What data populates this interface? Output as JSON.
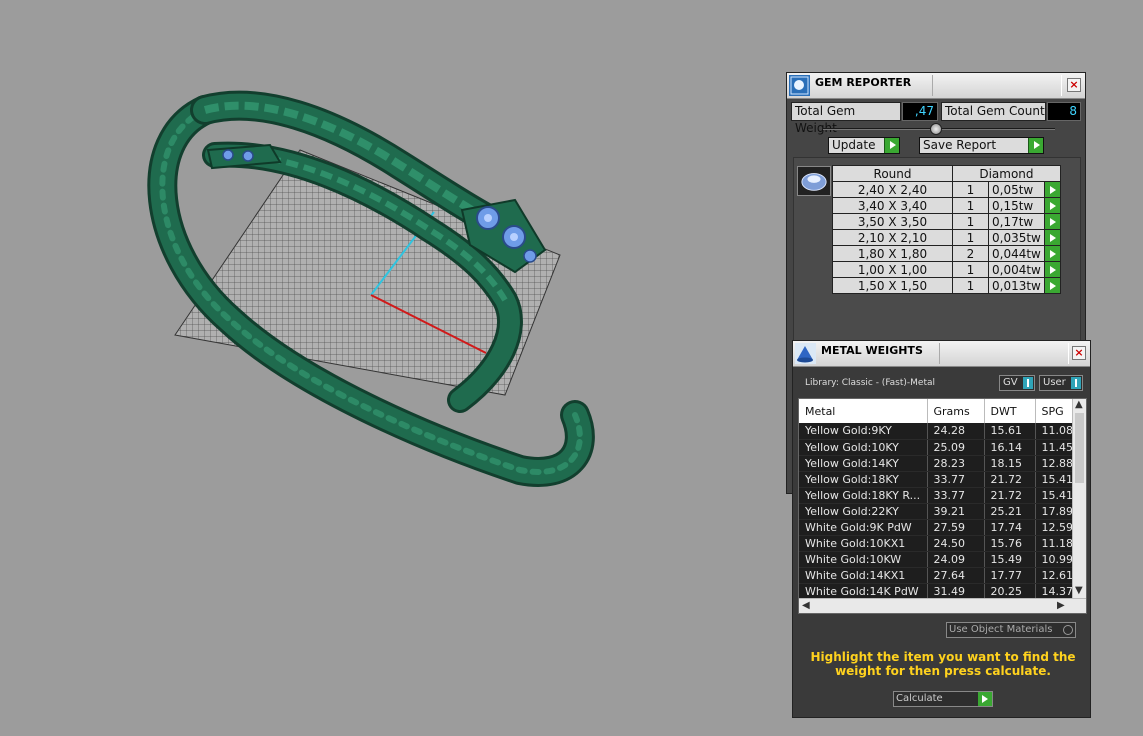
{
  "gem_reporter": {
    "title": "GEM REPORTER",
    "close": "×",
    "total_weight_label": "Total Gem Weight",
    "total_weight_value": ",47",
    "total_count_label": "Total Gem Count",
    "total_count_value": "8",
    "update_label": "Update",
    "save_label": "Save Report",
    "table": {
      "header_shape": "Round",
      "header_stone": "Diamond",
      "rows": [
        {
          "size": "2,40 X 2,40",
          "count": "1",
          "weight": "0,05tw"
        },
        {
          "size": "3,40 X 3,40",
          "count": "1",
          "weight": "0,15tw"
        },
        {
          "size": "3,50 X 3,50",
          "count": "1",
          "weight": "0,17tw"
        },
        {
          "size": "2,10 X 2,10",
          "count": "1",
          "weight": "0,035tw"
        },
        {
          "size": "1,80 X 1,80",
          "count": "2",
          "weight": "0,044tw"
        },
        {
          "size": "1,00 X 1,00",
          "count": "1",
          "weight": "0,004tw"
        },
        {
          "size": "1,50 X 1,50",
          "count": "1",
          "weight": "0,013tw"
        }
      ]
    }
  },
  "metal_weights": {
    "title": "METAL WEIGHTS",
    "close": "×",
    "library": "Library: Classic - (Fast)-Metal",
    "gv_label": "GV",
    "user_label": "User",
    "columns": [
      "Metal",
      "Grams",
      "DWT",
      "SPG"
    ],
    "rows": [
      {
        "metal": "Yellow Gold:9KY",
        "grams": "24.28",
        "dwt": "15.61",
        "spg": "11.08"
      },
      {
        "metal": "Yellow Gold:10KY",
        "grams": "25.09",
        "dwt": "16.14",
        "spg": "11.45"
      },
      {
        "metal": "Yellow Gold:14KY",
        "grams": "28.23",
        "dwt": "18.15",
        "spg": "12.88"
      },
      {
        "metal": "Yellow Gold:18KY",
        "grams": "33.77",
        "dwt": "21.72",
        "spg": "15.41"
      },
      {
        "metal": "Yellow Gold:18KY R...",
        "grams": "33.77",
        "dwt": "21.72",
        "spg": "15.41"
      },
      {
        "metal": "Yellow Gold:22KY",
        "grams": "39.21",
        "dwt": "25.21",
        "spg": "17.89"
      },
      {
        "metal": "White Gold:9K PdW",
        "grams": "27.59",
        "dwt": "17.74",
        "spg": "12.59"
      },
      {
        "metal": "White Gold:10KX1",
        "grams": "24.50",
        "dwt": "15.76",
        "spg": "11.18"
      },
      {
        "metal": "White Gold:10KW",
        "grams": "24.09",
        "dwt": "15.49",
        "spg": "10.99"
      },
      {
        "metal": "White Gold:14KX1",
        "grams": "27.64",
        "dwt": "17.77",
        "spg": "12.61"
      },
      {
        "metal": "White Gold:14K PdW",
        "grams": "31.49",
        "dwt": "20.25",
        "spg": "14.37"
      }
    ],
    "use_object_materials": "Use Object Materials",
    "hint": "Highlight the item you want to find the weight for then press calculate.",
    "calculate_label": "Calculate"
  },
  "colors": {
    "viewport_bg": "#9c9c9c",
    "model_green": "#1f6b4e",
    "gem_blue": "#6f9ce8",
    "hint_yellow": "#ffd21e",
    "value_cyan": "#3fd4ff",
    "go_green": "#3aa832"
  }
}
